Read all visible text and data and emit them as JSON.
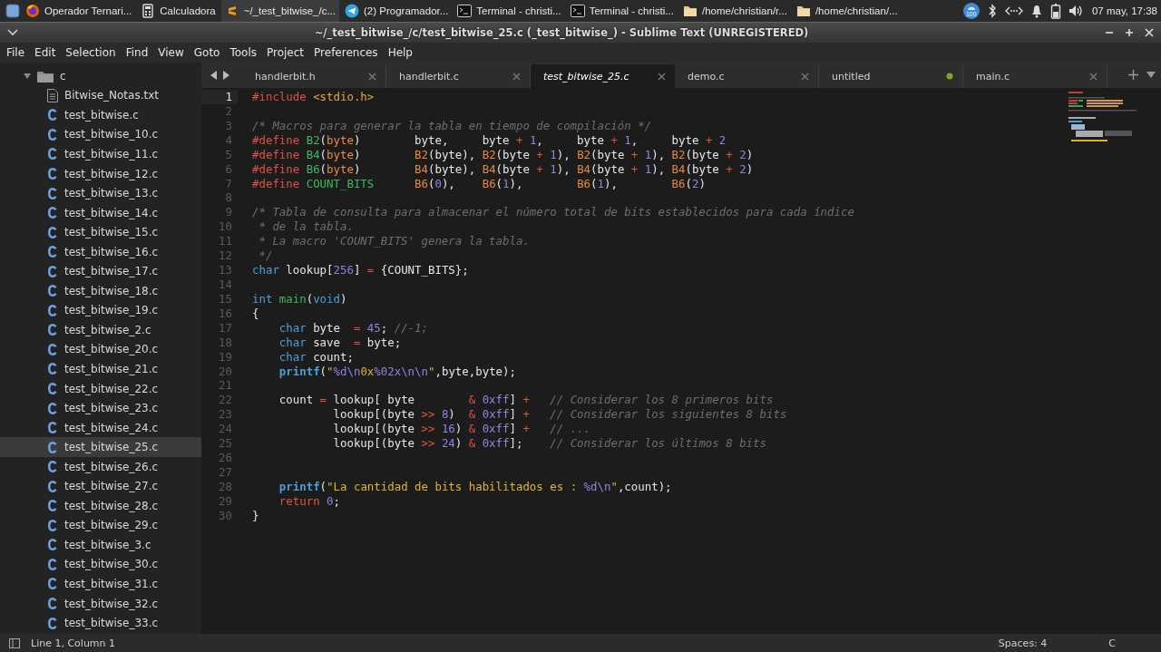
{
  "taskbar": {
    "apps": [
      {
        "kind": "browser",
        "label": "Operador Ternari...",
        "selected": false
      },
      {
        "kind": "calculator",
        "label": "Calculadora",
        "selected": false
      },
      {
        "kind": "editor",
        "label": "~/_test_bitwise_/c...",
        "selected": true
      },
      {
        "kind": "messenger",
        "label": "(2) Programador...",
        "selected": false
      },
      {
        "kind": "terminal",
        "label": "Terminal - christi...",
        "selected": false
      },
      {
        "kind": "terminal",
        "label": "Terminal - christi...",
        "selected": false
      },
      {
        "kind": "folder",
        "label": "/home/christian/r...",
        "selected": false
      },
      {
        "kind": "folder",
        "label": "/home/christian/...",
        "selected": false
      }
    ],
    "updates_badge": "100",
    "clock": "07 may, 17:38"
  },
  "window": {
    "title": "~/_test_bitwise_/c/test_bitwise_25.c (_test_bitwise_) - Sublime Text (UNREGISTERED)"
  },
  "menu": [
    "File",
    "Edit",
    "Selection",
    "Find",
    "View",
    "Goto",
    "Tools",
    "Project",
    "Preferences",
    "Help"
  ],
  "sidebar": {
    "items": [
      {
        "kind": "folder",
        "label": "c",
        "expanded": true,
        "children": [
          {
            "kind": "text",
            "label": "Bitwise_Notas.txt",
            "selected": false
          },
          {
            "kind": "c",
            "label": "test_bitwise.c",
            "selected": false
          },
          {
            "kind": "c",
            "label": "test_bitwise_10.c",
            "selected": false
          },
          {
            "kind": "c",
            "label": "test_bitwise_11.c",
            "selected": false
          },
          {
            "kind": "c",
            "label": "test_bitwise_12.c",
            "selected": false
          },
          {
            "kind": "c",
            "label": "test_bitwise_13.c",
            "selected": false
          },
          {
            "kind": "c",
            "label": "test_bitwise_14.c",
            "selected": false
          },
          {
            "kind": "c",
            "label": "test_bitwise_15.c",
            "selected": false
          },
          {
            "kind": "c",
            "label": "test_bitwise_16.c",
            "selected": false
          },
          {
            "kind": "c",
            "label": "test_bitwise_17.c",
            "selected": false
          },
          {
            "kind": "c",
            "label": "test_bitwise_18.c",
            "selected": false
          },
          {
            "kind": "c",
            "label": "test_bitwise_19.c",
            "selected": false
          },
          {
            "kind": "c",
            "label": "test_bitwise_2.c",
            "selected": false
          },
          {
            "kind": "c",
            "label": "test_bitwise_20.c",
            "selected": false
          },
          {
            "kind": "c",
            "label": "test_bitwise_21.c",
            "selected": false
          },
          {
            "kind": "c",
            "label": "test_bitwise_22.c",
            "selected": false
          },
          {
            "kind": "c",
            "label": "test_bitwise_23.c",
            "selected": false
          },
          {
            "kind": "c",
            "label": "test_bitwise_24.c",
            "selected": false
          },
          {
            "kind": "c",
            "label": "test_bitwise_25.c",
            "selected": true
          },
          {
            "kind": "c",
            "label": "test_bitwise_26.c",
            "selected": false
          },
          {
            "kind": "c",
            "label": "test_bitwise_27.c",
            "selected": false
          },
          {
            "kind": "c",
            "label": "test_bitwise_28.c",
            "selected": false
          },
          {
            "kind": "c",
            "label": "test_bitwise_29.c",
            "selected": false
          },
          {
            "kind": "c",
            "label": "test_bitwise_3.c",
            "selected": false
          },
          {
            "kind": "c",
            "label": "test_bitwise_30.c",
            "selected": false
          },
          {
            "kind": "c",
            "label": "test_bitwise_31.c",
            "selected": false
          },
          {
            "kind": "c",
            "label": "test_bitwise_32.c",
            "selected": false
          },
          {
            "kind": "c",
            "label": "test_bitwise_33.c",
            "selected": false
          }
        ]
      }
    ]
  },
  "tabs": [
    {
      "label": "handlerbit.h",
      "selected": false,
      "modified": false
    },
    {
      "label": "handlerbit.c",
      "selected": false,
      "modified": false
    },
    {
      "label": "test_bitwise_25.c",
      "selected": true,
      "modified": false
    },
    {
      "label": "demo.c",
      "selected": false,
      "modified": false
    },
    {
      "label": "untitled",
      "selected": false,
      "modified": true
    },
    {
      "label": "main.c",
      "selected": false,
      "modified": false
    }
  ],
  "editor": {
    "lines": [
      {
        "n": "1",
        "current": true,
        "tokens": [
          {
            "kind": "pre",
            "text": "#include "
          },
          {
            "kind": "inc",
            "text": "<stdio.h>"
          }
        ]
      },
      {
        "n": "2",
        "current": false
      },
      {
        "n": "3",
        "current": false,
        "tokens": [
          {
            "kind": "cmt",
            "text": "/* Macros para generar la tabla en tiempo de compilación */"
          }
        ]
      },
      {
        "n": "4",
        "current": false,
        "tokens": [
          {
            "kind": "pre",
            "text": "#define "
          },
          {
            "kind": "mac",
            "text": "B2"
          },
          {
            "kind": "pl",
            "text": "("
          },
          {
            "kind": "par",
            "text": "byte"
          },
          {
            "kind": "pl",
            "text": ")        byte,     byte "
          },
          {
            "kind": "op",
            "text": "+ "
          },
          {
            "kind": "num",
            "text": "1"
          },
          {
            "kind": "pl",
            "text": ",     byte "
          },
          {
            "kind": "op",
            "text": "+ "
          },
          {
            "kind": "num",
            "text": "1"
          },
          {
            "kind": "pl",
            "text": ",     byte "
          },
          {
            "kind": "op",
            "text": "+ "
          },
          {
            "kind": "num",
            "text": "2"
          }
        ]
      },
      {
        "n": "5",
        "current": false,
        "tokens": [
          {
            "kind": "pre",
            "text": "#define "
          },
          {
            "kind": "mac",
            "text": "B4"
          },
          {
            "kind": "pl",
            "text": "("
          },
          {
            "kind": "par",
            "text": "byte"
          },
          {
            "kind": "pl",
            "text": ")        "
          },
          {
            "kind": "call",
            "text": "B2"
          },
          {
            "kind": "pl",
            "text": "(byte), "
          },
          {
            "kind": "call",
            "text": "B2"
          },
          {
            "kind": "pl",
            "text": "(byte "
          },
          {
            "kind": "op",
            "text": "+ "
          },
          {
            "kind": "num",
            "text": "1"
          },
          {
            "kind": "pl",
            "text": "), "
          },
          {
            "kind": "call",
            "text": "B2"
          },
          {
            "kind": "pl",
            "text": "(byte "
          },
          {
            "kind": "op",
            "text": "+ "
          },
          {
            "kind": "num",
            "text": "1"
          },
          {
            "kind": "pl",
            "text": "), "
          },
          {
            "kind": "call",
            "text": "B2"
          },
          {
            "kind": "pl",
            "text": "(byte "
          },
          {
            "kind": "op",
            "text": "+ "
          },
          {
            "kind": "num",
            "text": "2"
          },
          {
            "kind": "pl",
            "text": ")"
          }
        ]
      },
      {
        "n": "6",
        "current": false,
        "tokens": [
          {
            "kind": "pre",
            "text": "#define "
          },
          {
            "kind": "mac",
            "text": "B6"
          },
          {
            "kind": "pl",
            "text": "("
          },
          {
            "kind": "par",
            "text": "byte"
          },
          {
            "kind": "pl",
            "text": ")        "
          },
          {
            "kind": "call",
            "text": "B4"
          },
          {
            "kind": "pl",
            "text": "(byte), "
          },
          {
            "kind": "call",
            "text": "B4"
          },
          {
            "kind": "pl",
            "text": "(byte "
          },
          {
            "kind": "op",
            "text": "+ "
          },
          {
            "kind": "num",
            "text": "1"
          },
          {
            "kind": "pl",
            "text": "), "
          },
          {
            "kind": "call",
            "text": "B4"
          },
          {
            "kind": "pl",
            "text": "(byte "
          },
          {
            "kind": "op",
            "text": "+ "
          },
          {
            "kind": "num",
            "text": "1"
          },
          {
            "kind": "pl",
            "text": "), "
          },
          {
            "kind": "call",
            "text": "B4"
          },
          {
            "kind": "pl",
            "text": "(byte "
          },
          {
            "kind": "op",
            "text": "+ "
          },
          {
            "kind": "num",
            "text": "2"
          },
          {
            "kind": "pl",
            "text": ")"
          }
        ]
      },
      {
        "n": "7",
        "current": false,
        "tokens": [
          {
            "kind": "pre",
            "text": "#define "
          },
          {
            "kind": "mac",
            "text": "COUNT_BITS      "
          },
          {
            "kind": "call",
            "text": "B6"
          },
          {
            "kind": "pl",
            "text": "("
          },
          {
            "kind": "num",
            "text": "0"
          },
          {
            "kind": "pl",
            "text": "),    "
          },
          {
            "kind": "call",
            "text": "B6"
          },
          {
            "kind": "pl",
            "text": "("
          },
          {
            "kind": "num",
            "text": "1"
          },
          {
            "kind": "pl",
            "text": "),        "
          },
          {
            "kind": "call",
            "text": "B6"
          },
          {
            "kind": "pl",
            "text": "("
          },
          {
            "kind": "num",
            "text": "1"
          },
          {
            "kind": "pl",
            "text": "),        "
          },
          {
            "kind": "call",
            "text": "B6"
          },
          {
            "kind": "pl",
            "text": "("
          },
          {
            "kind": "num",
            "text": "2"
          },
          {
            "kind": "pl",
            "text": ")"
          }
        ]
      },
      {
        "n": "8",
        "current": false
      },
      {
        "n": "9",
        "current": false,
        "tokens": [
          {
            "kind": "cmt",
            "text": "/* Tabla de consulta para almacenar el número total de bits establecidos para cada índice"
          }
        ]
      },
      {
        "n": "10",
        "current": false,
        "tokens": [
          {
            "kind": "cmt",
            "text": " * de la tabla."
          }
        ]
      },
      {
        "n": "11",
        "current": false,
        "tokens": [
          {
            "kind": "cmt",
            "text": " * La macro 'COUNT_BITS' genera la tabla."
          }
        ]
      },
      {
        "n": "12",
        "current": false,
        "tokens": [
          {
            "kind": "cmt",
            "text": " */"
          }
        ]
      },
      {
        "n": "13",
        "current": false,
        "tokens": [
          {
            "kind": "kw",
            "text": "char"
          },
          {
            "kind": "pl",
            "text": " lookup["
          },
          {
            "kind": "num",
            "text": "256"
          },
          {
            "kind": "pl",
            "text": "] "
          },
          {
            "kind": "op",
            "text": "="
          },
          {
            "kind": "pl",
            "text": " {COUNT_BITS};"
          }
        ]
      },
      {
        "n": "14",
        "current": false
      },
      {
        "n": "15",
        "current": false,
        "tokens": [
          {
            "kind": "kw",
            "text": "int "
          },
          {
            "kind": "fn",
            "text": "main"
          },
          {
            "kind": "pl",
            "text": "("
          },
          {
            "kind": "kw",
            "text": "void"
          },
          {
            "kind": "pl",
            "text": ")"
          }
        ]
      },
      {
        "n": "16",
        "current": false,
        "tokens": [
          {
            "kind": "pl",
            "text": "{"
          }
        ]
      },
      {
        "n": "17",
        "current": false,
        "tokens": [
          {
            "kind": "kw",
            "text": "    char"
          },
          {
            "kind": "pl",
            "text": " byte  "
          },
          {
            "kind": "op",
            "text": "= "
          },
          {
            "kind": "num",
            "text": "45"
          },
          {
            "kind": "pl",
            "text": "; "
          },
          {
            "kind": "cmt",
            "text": "//-1;"
          }
        ]
      },
      {
        "n": "18",
        "current": false,
        "tokens": [
          {
            "kind": "kw",
            "text": "    char"
          },
          {
            "kind": "pl",
            "text": " save  "
          },
          {
            "kind": "op",
            "text": "="
          },
          {
            "kind": "pl",
            "text": " byte;"
          }
        ]
      },
      {
        "n": "19",
        "current": false,
        "tokens": [
          {
            "kind": "kw",
            "text": "    char"
          },
          {
            "kind": "pl",
            "text": " count;"
          }
        ]
      },
      {
        "n": "20",
        "current": false,
        "tokens": [
          {
            "kind": "bi",
            "text": "    printf"
          },
          {
            "kind": "pl",
            "text": "("
          },
          {
            "kind": "str",
            "text": "\""
          },
          {
            "kind": "esc",
            "text": "%d\\n"
          },
          {
            "kind": "str",
            "text": "0x"
          },
          {
            "kind": "esc",
            "text": "%02x\\n\\n"
          },
          {
            "kind": "str",
            "text": "\""
          },
          {
            "kind": "pl",
            "text": ",byte,byte);"
          }
        ]
      },
      {
        "n": "21",
        "current": false
      },
      {
        "n": "22",
        "current": false,
        "tokens": [
          {
            "kind": "pl",
            "text": "    count "
          },
          {
            "kind": "op",
            "text": "="
          },
          {
            "kind": "pl",
            "text": " lookup[ byte        "
          },
          {
            "kind": "op",
            "text": "& "
          },
          {
            "kind": "num",
            "text": "0xff"
          },
          {
            "kind": "pl",
            "text": "] "
          },
          {
            "kind": "op",
            "text": "+   "
          },
          {
            "kind": "cmt",
            "text": "// Considerar los 8 primeros bits"
          }
        ]
      },
      {
        "n": "23",
        "current": false,
        "tokens": [
          {
            "kind": "pl",
            "text": "            lookup[(byte "
          },
          {
            "kind": "op",
            "text": ">> "
          },
          {
            "kind": "num",
            "text": "8"
          },
          {
            "kind": "pl",
            "text": ")  "
          },
          {
            "kind": "op",
            "text": "& "
          },
          {
            "kind": "num",
            "text": "0xff"
          },
          {
            "kind": "pl",
            "text": "] "
          },
          {
            "kind": "op",
            "text": "+   "
          },
          {
            "kind": "cmt",
            "text": "// Considerar los siguientes 8 bits"
          }
        ]
      },
      {
        "n": "24",
        "current": false,
        "tokens": [
          {
            "kind": "pl",
            "text": "            lookup[(byte "
          },
          {
            "kind": "op",
            "text": ">> "
          },
          {
            "kind": "num",
            "text": "16"
          },
          {
            "kind": "pl",
            "text": ") "
          },
          {
            "kind": "op",
            "text": "& "
          },
          {
            "kind": "num",
            "text": "0xff"
          },
          {
            "kind": "pl",
            "text": "] "
          },
          {
            "kind": "op",
            "text": "+   "
          },
          {
            "kind": "cmt",
            "text": "// ..."
          }
        ]
      },
      {
        "n": "25",
        "current": false,
        "tokens": [
          {
            "kind": "pl",
            "text": "            lookup[(byte "
          },
          {
            "kind": "op",
            "text": ">> "
          },
          {
            "kind": "num",
            "text": "24"
          },
          {
            "kind": "pl",
            "text": ") "
          },
          {
            "kind": "op",
            "text": "& "
          },
          {
            "kind": "num",
            "text": "0xff"
          },
          {
            "kind": "pl",
            "text": "];    "
          },
          {
            "kind": "cmt",
            "text": "// Considerar los últimos 8 bits"
          }
        ]
      },
      {
        "n": "26",
        "current": false
      },
      {
        "n": "27",
        "current": false
      },
      {
        "n": "28",
        "current": false,
        "tokens": [
          {
            "kind": "bi",
            "text": "    printf"
          },
          {
            "kind": "pl",
            "text": "("
          },
          {
            "kind": "str",
            "text": "\"La cantidad de bits habilitados es : "
          },
          {
            "kind": "esc",
            "text": "%d\\n"
          },
          {
            "kind": "str",
            "text": "\""
          },
          {
            "kind": "pl",
            "text": ",count);"
          }
        ]
      },
      {
        "n": "29",
        "current": false,
        "tokens": [
          {
            "kind": "ret",
            "text": "    return "
          },
          {
            "kind": "num",
            "text": "0"
          },
          {
            "kind": "pl",
            "text": ";"
          }
        ]
      },
      {
        "n": "30",
        "current": false,
        "tokens": [
          {
            "kind": "pl",
            "text": "}"
          }
        ]
      }
    ]
  },
  "status_bar": {
    "position": "Line 1, Column 1",
    "indentation": "Spaces: 4",
    "syntax": "C"
  }
}
